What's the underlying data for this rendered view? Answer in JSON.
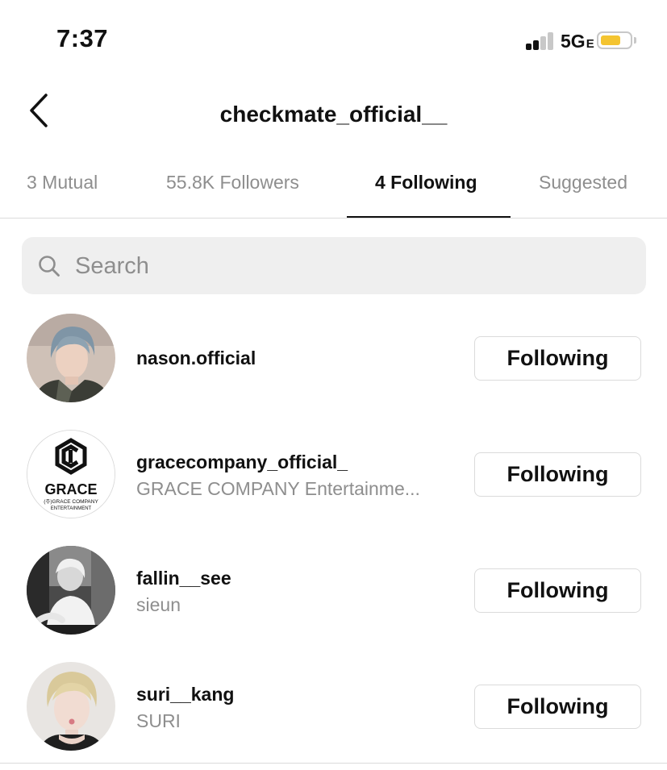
{
  "status_bar": {
    "time": "7:37",
    "network": "5G",
    "network_suffix": "E",
    "battery_color": "#f4c430"
  },
  "header": {
    "back_icon": "chevron-left-icon",
    "title": "checkmate_official__"
  },
  "tabs": [
    {
      "label": "3 Mutual",
      "active": false
    },
    {
      "label": "55.8K Followers",
      "active": false
    },
    {
      "label": "4 Following",
      "active": true
    },
    {
      "label": "Suggested",
      "active": false
    }
  ],
  "search": {
    "placeholder": "Search",
    "value": "",
    "icon": "search-icon"
  },
  "accounts": [
    {
      "username": "nason.official",
      "full_name": "",
      "button": "Following",
      "avatar": "photo"
    },
    {
      "username": "gracecompany_official_",
      "full_name": "GRACE COMPANY Entertainme...",
      "button": "Following",
      "avatar": "logo",
      "logo_text": {
        "main": "GRACE",
        "line1": "(주)GRACE COMPANY",
        "line2": "ENTERTAINMENT"
      }
    },
    {
      "username": "fallin__see",
      "full_name": "sieun",
      "button": "Following",
      "avatar": "photo"
    },
    {
      "username": "suri__kang",
      "full_name": "SURI",
      "button": "Following",
      "avatar": "photo"
    }
  ],
  "colors": {
    "muted_text": "#8e8e8e",
    "divider": "#dbdbdb",
    "search_bg": "#efefef"
  }
}
